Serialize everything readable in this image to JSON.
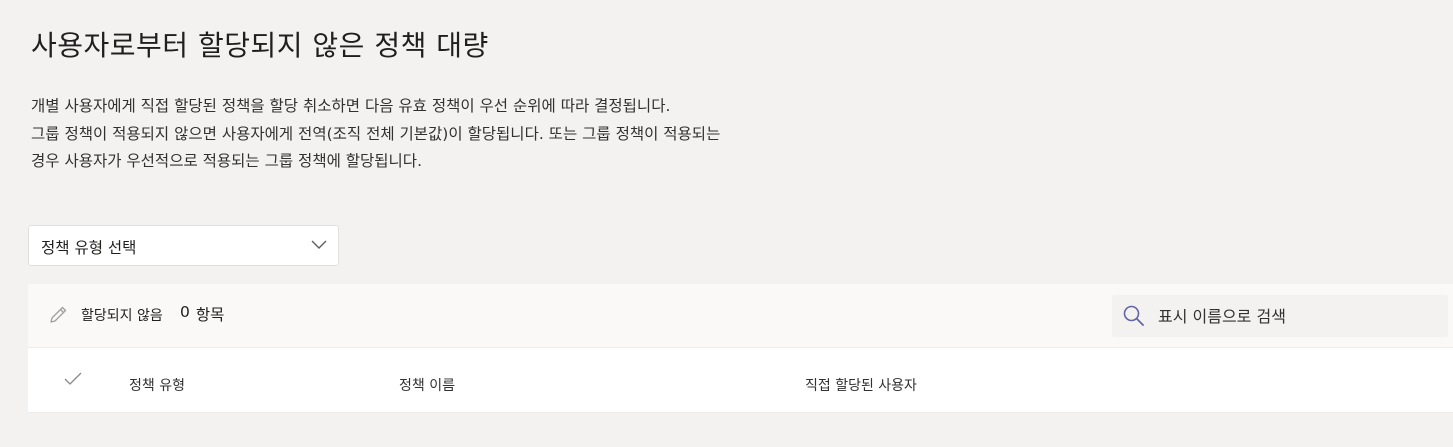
{
  "page": {
    "title": "사용자로부터 할당되지 않은 정책 대량",
    "description_lines": [
      "개별 사용자에게 직접 할당된 정책을 할당 취소하면 다음 유효 정책이 우선 순위에 따라 결정됩니다.",
      "그룹 정책이 적용되지 않으면 사용자에게 전역(조직 전체 기본값)이 할당됩니다. 또는 그룹 정책이 적용되는",
      "경우 사용자가 우선적으로 적용되는 그룹 정책에 할당됩니다."
    ]
  },
  "policy_type_select": {
    "selected": "정책 유형 선택",
    "icon": "chevron-down-icon"
  },
  "toolbar": {
    "unassign_label": "할당되지 않음",
    "unassign_icon": "pencil-icon",
    "count": "0",
    "count_suffix": "항목"
  },
  "search": {
    "placeholder": "표시 이름으로 검색",
    "icon": "search-icon"
  },
  "table": {
    "columns": [
      "정책 유형",
      "정책 이름",
      "직접 할당된 사용자"
    ],
    "rows": []
  },
  "colors": {
    "page_background": "#f3f2f1",
    "panel_background": "#ffffff",
    "search_icon": "#6264a7",
    "text": "#323130"
  }
}
